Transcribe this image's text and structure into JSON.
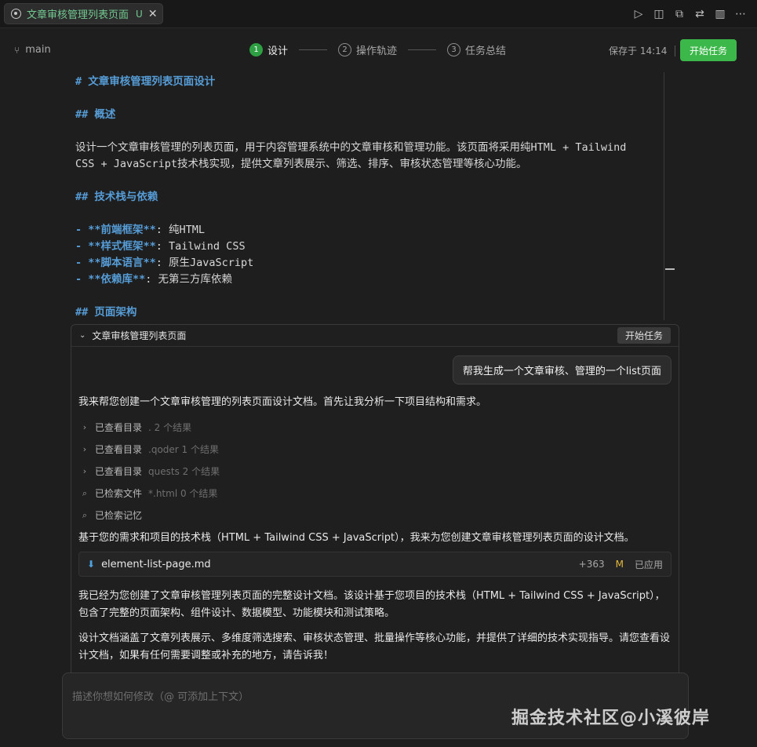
{
  "tab": {
    "title": "文章审核管理列表页面",
    "status": "U",
    "close": "✕"
  },
  "toolbar": {
    "icons": [
      "play-icon",
      "preview-icon",
      "copy-icon",
      "diff-icon",
      "split-icon",
      "more-icon"
    ]
  },
  "stepbar": {
    "branch": "main",
    "steps": [
      {
        "num": "1",
        "label": "设计",
        "active": true
      },
      {
        "num": "2",
        "label": "操作轨迹",
        "active": false
      },
      {
        "num": "3",
        "label": "任务总结",
        "active": false
      }
    ],
    "saved": "保存于 14:14",
    "start_label": "开始任务"
  },
  "editor": {
    "lines": [
      {
        "prefix": "#",
        "text": "文章审核管理列表页面设计"
      },
      {
        "prefix": "##",
        "text": "概述"
      },
      {
        "text": "设计一个文章审核管理的列表页面，用于内容管理系统中的文章审核和管理功能。该页面将采用纯HTML + Tailwind"
      },
      {
        "text": "CSS + JavaScript技术栈实现，提供文章列表展示、筛选、排序、审核状态管理等核心功能。"
      },
      {
        "prefix": "##",
        "text": "技术栈与依赖"
      },
      {
        "bullet": "- **前端框架**",
        "text": ": 纯HTML"
      },
      {
        "bullet": "- **样式框架**",
        "text": ": Tailwind CSS"
      },
      {
        "bullet": "- **脚本语言**",
        "text": ": 原生JavaScript"
      },
      {
        "bullet": "- **依赖库**",
        "text": ": 无第三方库依赖"
      },
      {
        "prefix": "##",
        "text": "页面架构"
      }
    ]
  },
  "chat": {
    "title": "文章审核管理列表页面",
    "start_label": "开始任务",
    "user_message": "帮我生成一个文章审核、管理的一个list页面",
    "intro": "我来帮您创建一个文章审核管理的列表页面设计文档。首先让我分析一下项目结构和需求。",
    "tools": [
      {
        "icon": "chevron-right-icon",
        "glyph": "›",
        "label": "已查看目录",
        "detail": ". 2 个结果"
      },
      {
        "icon": "chevron-right-icon",
        "glyph": "›",
        "label": "已查看目录",
        "detail": ".qoder 1 个结果"
      },
      {
        "icon": "chevron-right-icon",
        "glyph": "›",
        "label": "已查看目录",
        "detail": "quests 2 个结果"
      },
      {
        "icon": "search-icon",
        "glyph": "⌕",
        "label": "已检索文件",
        "detail": "*.html 0 个结果"
      },
      {
        "icon": "search-icon",
        "glyph": "⌕",
        "label": "已检索记忆",
        "detail": ""
      }
    ],
    "followup": "基于您的需求和项目的技术栈（HTML + Tailwind CSS + JavaScript），我来为您创建文章审核管理列表页面的设计文档。",
    "file": {
      "name": "element-list-page.md",
      "adds": "+363",
      "mark": "M",
      "state": "已应用"
    },
    "summary1": "我已经为您创建了文章审核管理列表页面的完整设计文档。该设计基于您项目的技术栈（HTML + Tailwind CSS + JavaScript），包含了完整的页面架构、组件设计、数据模型、功能模块和测试策略。",
    "summary2": "设计文档涵盖了文章列表展示、多维度筛选搜索、审核状态管理、批量操作等核心功能，并提供了详细的技术实现指导。请您查看设计文档，如果有任何需要调整或补充的地方，请告诉我！"
  },
  "input": {
    "placeholder": "描述你想如何修改（@ 可添加上下文）"
  },
  "watermark": "掘金技术社区@小溪彼岸",
  "colors": {
    "accent_green": "#3cb84a",
    "heading_blue": "#569cd6",
    "untracked_green": "#73c991",
    "modified_yellow": "#e2b93d"
  }
}
